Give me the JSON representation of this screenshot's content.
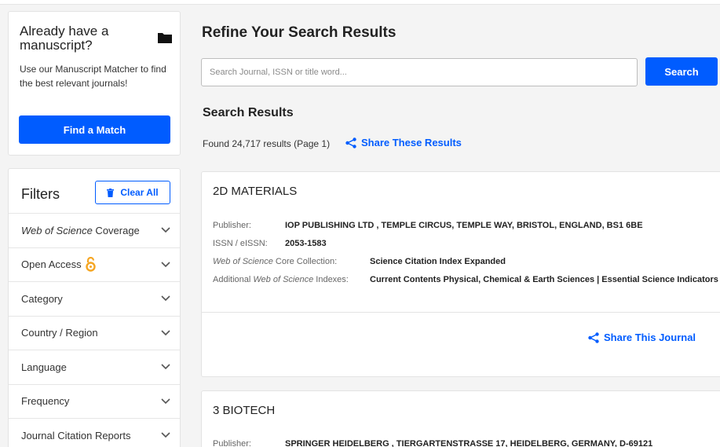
{
  "colors": {
    "accent": "#005cff",
    "open_access": "#f5a623"
  },
  "matcher": {
    "title": "Already have a manuscript?",
    "description": "Use our Manuscript Matcher to find the best relevant journals!",
    "button_label": "Find a Match"
  },
  "filters": {
    "title": "Filters",
    "clear_label": "Clear All",
    "items": [
      {
        "italic_part": "Web of Science",
        "rest": " Coverage"
      },
      {
        "italic_part": "",
        "rest": "Open Access",
        "icon": "open-access-icon"
      },
      {
        "italic_part": "",
        "rest": "Category"
      },
      {
        "italic_part": "",
        "rest": "Country / Region"
      },
      {
        "italic_part": "",
        "rest": "Language"
      },
      {
        "italic_part": "",
        "rest": "Frequency"
      },
      {
        "italic_part": "",
        "rest": "Journal Citation Reports"
      }
    ]
  },
  "main": {
    "title": "Refine Your Search Results",
    "search_placeholder": "Search Journal, ISSN or title word...",
    "search_button": "Search",
    "results_title": "Search Results",
    "results_count": "Found 24,717 results (Page 1)",
    "share_results": "Share These Results"
  },
  "journals": [
    {
      "name": "2D MATERIALS",
      "publisher_label": "Publisher:",
      "publisher": "IOP PUBLISHING LTD , TEMPLE CIRCUS, TEMPLE WAY, BRISTOL, ENGLAND, BS1 6BE",
      "issn_label": "ISSN / eISSN:",
      "issn": "2053-1583",
      "core_label_italic": "Web of Science",
      "core_label_rest": " Core Collection:",
      "core": "Science Citation Index Expanded",
      "additional_label_pre": "Additional ",
      "additional_label_italic": "Web of Science",
      "additional_label_rest": " Indexes:",
      "additional": "Current Contents Physical, Chemical & Earth Sciences | Essential Science Indicators",
      "share_label": "Share This Journal"
    },
    {
      "name": "3 BIOTECH",
      "publisher_label": "Publisher:",
      "publisher": "SPRINGER HEIDELBERG , TIERGARTENSTRASSE 17, HEIDELBERG, GERMANY, D-69121"
    }
  ]
}
